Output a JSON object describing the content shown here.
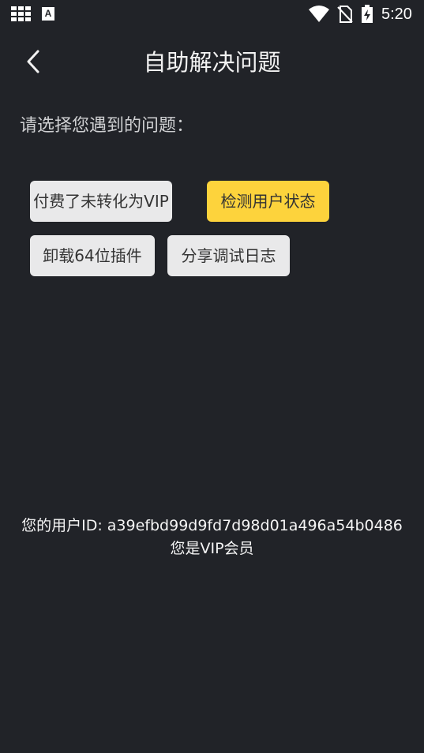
{
  "status_bar": {
    "time": "5:20",
    "app_icon_letter": "A",
    "icons": [
      "grid-icon",
      "a-notification-icon",
      "wifi-icon",
      "no-sim-icon",
      "battery-charging-icon"
    ]
  },
  "header": {
    "title": "自助解决问题",
    "back_icon": "chevron-left-icon"
  },
  "prompt": "请选择您遇到的问题：",
  "options": [
    {
      "label": "付费了未转化为VIP",
      "selected": false
    },
    {
      "label": "检测用户状态",
      "selected": true
    },
    {
      "label": "卸载64位插件",
      "selected": false
    },
    {
      "label": "分享调试日志",
      "selected": false
    }
  ],
  "info": {
    "user_id_line": "您的用户ID: a39efbd99d9fd7d98d01a496a54b0486",
    "vip_status": "您是VIP会员"
  },
  "colors": {
    "background": "#212328",
    "option_default": "#e9e9ea",
    "option_selected": "#fdd33c"
  }
}
